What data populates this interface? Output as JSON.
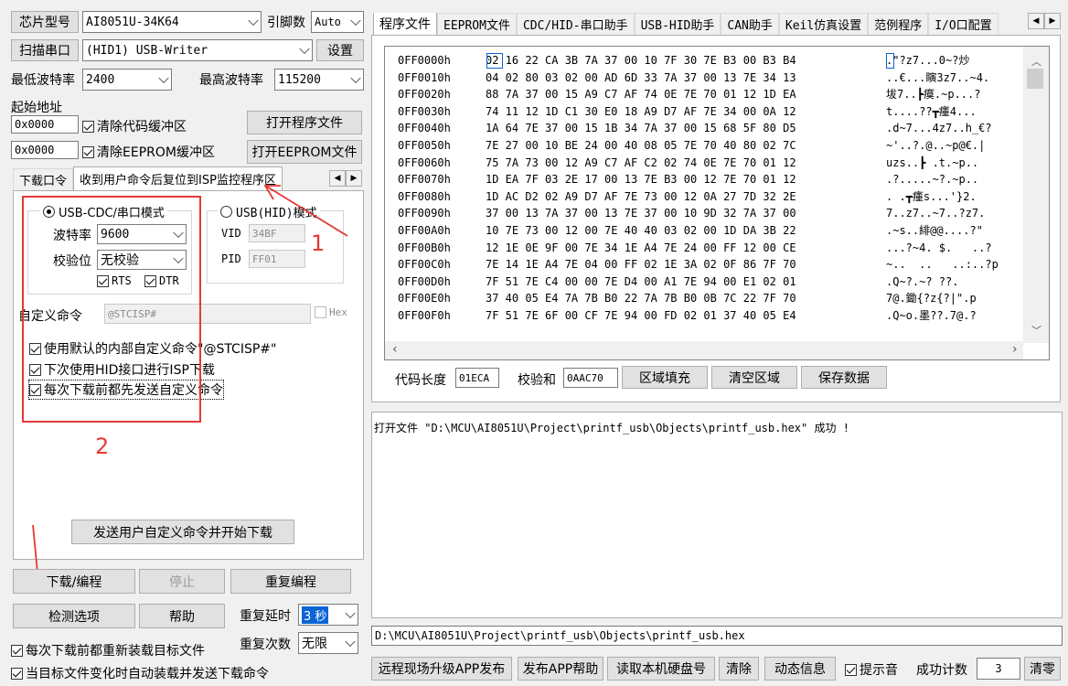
{
  "top": {
    "chip_label": "芯片型号",
    "chip_value": "AI8051U-34K64",
    "pins_label": "引脚数",
    "pins_value": "Auto",
    "scan_label": "扫描串口",
    "port_value": "(HID1) USB-Writer",
    "settings_label": "设置",
    "min_baud_label": "最低波特率",
    "min_baud_value": "2400",
    "max_baud_label": "最高波特率",
    "max_baud_value": "115200",
    "start_addr_label": "起始地址",
    "addr1": "0x0000",
    "clear_code_label": "清除代码缓冲区",
    "open_prog_label": "打开程序文件",
    "addr2": "0x0000",
    "clear_eeprom_label": "清除EEPROM缓冲区",
    "open_eeprom_label": "打开EEPROM文件"
  },
  "left_tabs": [
    {
      "label": "下载口令"
    },
    {
      "label": "收到用户命令后复位到ISP监控程序区"
    }
  ],
  "panel": {
    "usb_cdc_label": "USB-CDC/串口模式",
    "usb_hid_label": "USB(HID)模式",
    "baud_label": "波特率",
    "baud_value": "9600",
    "parity_label": "校验位",
    "parity_value": "无校验",
    "rts_label": "RTS",
    "dtr_label": "DTR",
    "vid_label": "VID",
    "vid_value": "34BF",
    "pid_label": "PID",
    "pid_value": "FF01",
    "custom_cmd_label": "自定义命令",
    "custom_cmd_value": "@STCISP#",
    "hex_label": "Hex",
    "opt1": "使用默认的内部自定义命令\"@STCISP#\"",
    "opt2": "下次使用HID接口进行ISP下载",
    "opt3": "每次下载前都先发送自定义命令",
    "send_btn": "发送用户自定义命令并开始下载"
  },
  "annotations": {
    "num1": "1",
    "num2": "2",
    "red": "#e53935"
  },
  "bottom": {
    "download_btn": "下载/编程",
    "stop_btn": "停止",
    "reprog_btn": "重复编程",
    "detect_btn": "检测选项",
    "help_btn": "帮助",
    "delay_label": "重复延时",
    "delay_value": "3 秒",
    "count_label": "重复次数",
    "count_value": "无限",
    "reload_label": "每次下载前都重新装载目标文件",
    "auto_label": "当目标文件变化时自动装载并发送下载命令"
  },
  "right_tabs": [
    {
      "label": "程序文件"
    },
    {
      "label": "EEPROM文件"
    },
    {
      "label": "CDC/HID-串口助手"
    },
    {
      "label": "USB-HID助手"
    },
    {
      "label": "CAN助手"
    },
    {
      "label": "Keil仿真设置"
    },
    {
      "label": "范例程序"
    },
    {
      "label": "I/O口配置"
    }
  ],
  "hex": {
    "rows": [
      {
        "addr": "0FF0000h",
        "bytes": "02 16 22 CA 3B 7A 37 00 10 7F 30 7E B3 00 B3 B4",
        "ascii": ".\"?z7...0~?炒"
      },
      {
        "addr": "0FF0010h",
        "bytes": "04 02 80 03 02 00 AD 6D 33 7A 37 00 13 7E 34 13",
        "ascii": "..€...瞚3z7..~4."
      },
      {
        "addr": "0FF0020h",
        "bytes": "88 7A 37 00 15 A9 C7 AF 74 0E 7E 70 01 12 1D EA",
        "ascii": "坺7..┣瘼.~p...?"
      },
      {
        "addr": "0FF0030h",
        "bytes": "74 11 12 1D C1 30 E0 18 A9 D7 AF 7E 34 00 0A 12",
        "ascii": "t....??┳瘇4..."
      },
      {
        "addr": "0FF0040h",
        "bytes": "1A 64 7E 37 00 15 1B 34 7A 37 00 15 68 5F 80 D5",
        "ascii": ".d~7...4z7..h_€?"
      },
      {
        "addr": "0FF0050h",
        "bytes": "7E 27 00 10 BE 24 00 40 08 05 7E 70 40 80 02 7C",
        "ascii": "~'..?.@..~p@€.|"
      },
      {
        "addr": "0FF0060h",
        "bytes": "75 7A 73 00 12 A9 C7 AF C2 02 74 0E 7E 70 01 12",
        "ascii": "uzs..┣ .t.~p.."
      },
      {
        "addr": "0FF0070h",
        "bytes": "1D EA 7F 03 2E 17 00 13 7E B3 00 12 7E 70 01 12",
        "ascii": ".?.....~?.~p.."
      },
      {
        "addr": "0FF0080h",
        "bytes": "1D AC D2 02 A9 D7 AF 7E 73 00 12 0A 27 7D 32 2E",
        "ascii": ". .┳瘇s...'}2."
      },
      {
        "addr": "0FF0090h",
        "bytes": "37 00 13 7A 37 00 13 7E 37 00 10 9D 32 7A 37 00",
        "ascii": "7..z7..~7..?z7."
      },
      {
        "addr": "0FF00A0h",
        "bytes": "10 7E 73 00 12 00 7E 40 40 03 02 00 1D DA 3B 22",
        "ascii": ".~s..緋@@....?\""
      },
      {
        "addr": "0FF00B0h",
        "bytes": "12 1E 0E 9F 00 7E 34 1E A4 7E 24 00 FF 12 00 CE",
        "ascii": "...?~4. $.   ..?"
      },
      {
        "addr": "0FF00C0h",
        "bytes": "7E 14 1E A4 7E 04 00 FF 02 1E 3A 02 0F 86 7F 70",
        "ascii": "~..  ..   ..:..?p"
      },
      {
        "addr": "0FF00D0h",
        "bytes": "7F 51 7E C4 00 00 7E D4 00 A1 7E 94 00 E1 02 01",
        "ascii": ".Q~?.~? ??."
      },
      {
        "addr": "0FF00E0h",
        "bytes": "37 40 05 E4 7A 7B B0 22 7A 7B B0 0B 7C 22 7F 70",
        "ascii": "7@.鋤{?z{?|\".p"
      },
      {
        "addr": "0FF00F0h",
        "bytes": "7F 51 7E 6F 00 CF 7E 94 00 FD 02 01 37 40 05 E4",
        "ascii": ".Q~o.墨??.7@.?"
      }
    ],
    "code_len_label": "代码长度",
    "code_len_value": "01ECA",
    "checksum_label": "校验和",
    "checksum_value": "0AAC70",
    "fill_btn": "区域填充",
    "clear_btn": "清空区域",
    "save_btn": "保存数据"
  },
  "log": {
    "message": "打开文件 \"D:\\MCU\\AI8051U\\Project\\printf_usb\\Objects\\printf_usb.hex\" 成功 !",
    "path": "D:\\MCU\\AI8051U\\Project\\printf_usb\\Objects\\printf_usb.hex"
  },
  "status_bar": {
    "remote_btn": "远程现场升级APP发布",
    "app_help_btn": "发布APP帮助",
    "disk_btn": "读取本机硬盘号",
    "clear_btn": "清除",
    "dynamic_btn": "动态信息",
    "sound_label": "提示音",
    "success_label": "成功计数",
    "success_value": "3",
    "reset_btn": "清零"
  }
}
